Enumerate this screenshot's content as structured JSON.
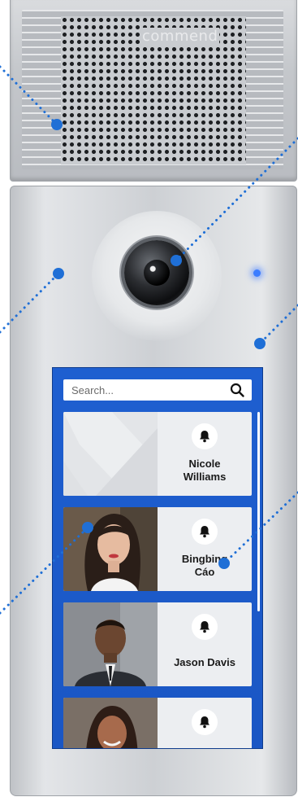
{
  "device": {
    "brand": "commend",
    "led_color": "#3b7cff",
    "panel_color": "#cdd0d4"
  },
  "screen": {
    "background_color": "#1e5fd0",
    "search": {
      "placeholder": "Search...",
      "icon": "search-icon"
    },
    "contacts": [
      {
        "name_line1": "Nicole",
        "name_line2": "Williams",
        "photo": "placeholder-abstract",
        "icon": "bell-icon"
      },
      {
        "name_line1": "Bingbing",
        "name_line2": "Cáo",
        "photo": "woman-portrait",
        "icon": "bell-icon"
      },
      {
        "name_line1": "Jason Davis",
        "name_line2": "",
        "photo": "man-portrait",
        "icon": "bell-icon"
      },
      {
        "name_line1": "",
        "name_line2": "",
        "photo": "woman-portrait-2",
        "icon": "bell-icon"
      }
    ]
  },
  "callout_color": "#1f6fd6"
}
